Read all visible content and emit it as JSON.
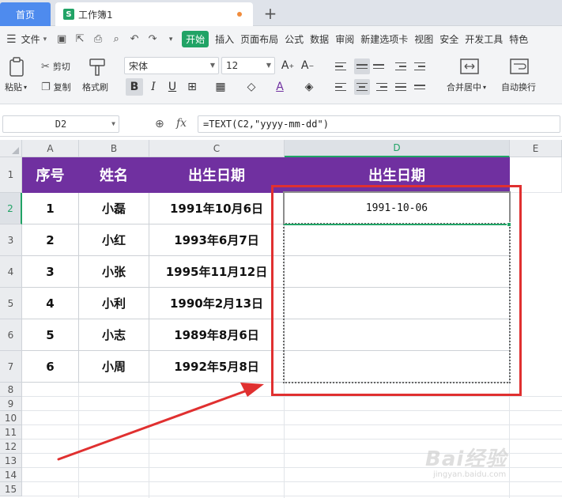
{
  "tabs": {
    "home_label": "首页",
    "doc_icon": "S",
    "doc_label": "工作簿1",
    "add_symbol": "+"
  },
  "menu": {
    "file_label": "文件",
    "tabs": [
      "开始",
      "插入",
      "页面布局",
      "公式",
      "数据",
      "审阅",
      "新建选项卡",
      "视图",
      "安全",
      "开发工具",
      "特色"
    ],
    "active_tab": "开始",
    "active_color": "#21a366"
  },
  "ribbon": {
    "paste_label": "粘贴",
    "cut_label": "剪切",
    "copy_label": "复制",
    "format_painter_label": "格式刷",
    "font_name": "宋体",
    "font_size": "12",
    "merge_label": "合并居中",
    "wrap_label": "自动换行"
  },
  "formula_bar": {
    "name_box": "D2",
    "fx_label": "fx",
    "formula": "=TEXT(C2,\"yyyy-mm-dd\")"
  },
  "sheet": {
    "columns": [
      "A",
      "B",
      "C",
      "D",
      "E"
    ],
    "selected_column": "D",
    "selected_row": "2",
    "row_numbers": [
      "1",
      "2",
      "3",
      "4",
      "5",
      "6",
      "7",
      "8",
      "9",
      "10",
      "11",
      "12",
      "13",
      "14",
      "15"
    ],
    "header_fill": "#7030a0",
    "headers": [
      "序号",
      "姓名",
      "出生日期",
      "出生日期"
    ],
    "rows": [
      [
        "1",
        "小磊",
        "1991年10月6日",
        "1991-10-06"
      ],
      [
        "2",
        "小红",
        "1993年6月7日",
        ""
      ],
      [
        "3",
        "小张",
        "1995年11月12日",
        ""
      ],
      [
        "4",
        "小利",
        "1990年2月13日",
        ""
      ],
      [
        "5",
        "小志",
        "1989年8月6日",
        ""
      ],
      [
        "6",
        "小周",
        "1992年5月8日",
        ""
      ]
    ]
  },
  "annotation": {
    "color": "#e03030"
  },
  "watermark": {
    "brand": "Bai经验",
    "url": "jingyan.baidu.com"
  }
}
